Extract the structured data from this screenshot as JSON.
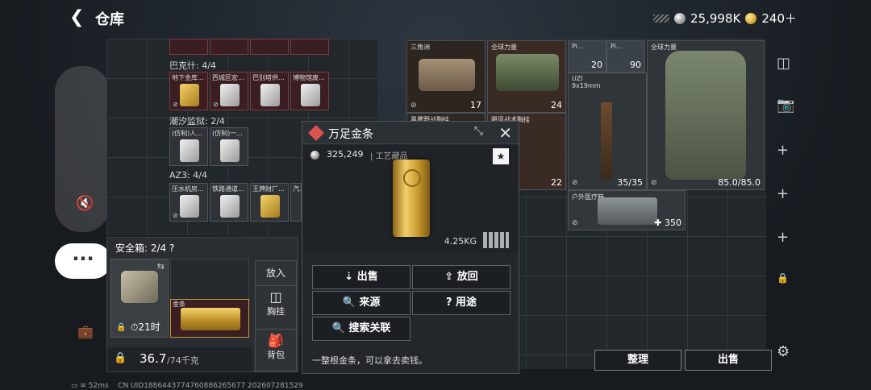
{
  "header": {
    "back_icon": "back-arrow-icon",
    "title": "仓库",
    "silver_amount": "25,998K",
    "gold_amount": "240＋"
  },
  "left_pane": {
    "sections": [
      {
        "label": "巴克什: 4/4"
      },
      {
        "label": "潮汐监狱: 2/4"
      },
      {
        "label": "AZ3: 4/4"
      }
    ],
    "row1_items": [
      "地下金库...",
      "西城区宏...",
      "巴别塔供...",
      "博物馆废..."
    ],
    "row2_items": [
      "(仿制)人...",
      "(仿制)一..."
    ],
    "row3_items": [
      "压水机房...",
      "铁路通道...",
      "王牌财厂...",
      "汽..."
    ]
  },
  "right_pane": {
    "items": [
      {
        "label": "三角洲",
        "count": "17"
      },
      {
        "label": "全球力量",
        "count": "24"
      },
      {
        "label": "Pi...",
        "count": "20"
      },
      {
        "label": "Pi...",
        "count": "90"
      },
      {
        "label": "全球力量",
        "count": ""
      },
      {
        "label": "黑鹰野战胸挂",
        "count": ""
      },
      {
        "label": "飓风战术胸挂",
        "count": "22"
      },
      {
        "label": "UZI\n9x19mm",
        "count": "35/35"
      },
      {
        "label": "",
        "count": "85.0/85.0"
      },
      {
        "label": "户外医疗箱",
        "count": "350"
      }
    ]
  },
  "safe_box": {
    "title": "安全箱: 2/4",
    "help": "?",
    "timer": "21时",
    "gold_label": "金条",
    "weight": "36.7",
    "weight_cap": "/74千克"
  },
  "put_panel": {
    "title": "放入",
    "chest": "胸挂",
    "backpack": "背包"
  },
  "popup": {
    "title": "万足金条",
    "price": "325,249",
    "category": "工艺藏品",
    "weight": "4.25KG",
    "buttons": {
      "sell": "出售",
      "return": "放回",
      "source": "来源",
      "use": "用途",
      "search": "搜索关联"
    },
    "description": "一整根金条，可以拿去卖钱。"
  },
  "bottom": {
    "organize": "整理",
    "sell": "出售"
  },
  "status_bar": "CN UID1886443774760886265677 202607281529",
  "ping": "52ms"
}
